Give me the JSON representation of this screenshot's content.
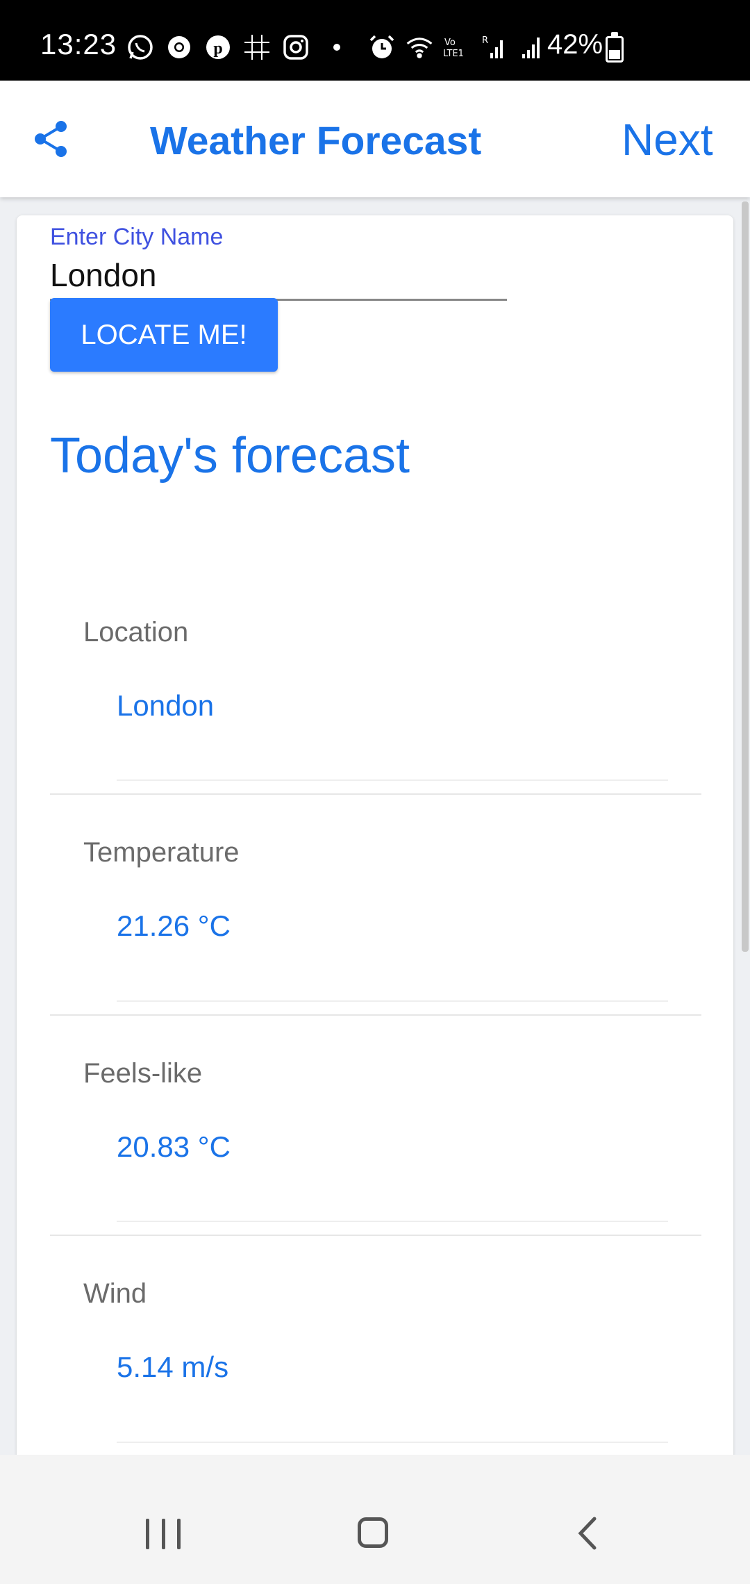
{
  "status_bar": {
    "time": "13:23",
    "battery": "42%",
    "icons": [
      "whatsapp-icon",
      "chrome-icon",
      "pinterest-icon",
      "sudoku-icon",
      "instagram-icon",
      "dot-icon",
      "alarm-icon",
      "wifi-icon",
      "volte-icon",
      "signal-icon",
      "signal-icon",
      "battery-charging-icon"
    ]
  },
  "app_bar": {
    "title": "Weather Forecast",
    "next_label": "Next",
    "share_icon": "share-icon"
  },
  "form": {
    "city_label": "Enter City Name",
    "city_value": "London",
    "locate_button": "LOCATE ME!"
  },
  "forecast": {
    "heading": "Today's forecast",
    "rows": [
      {
        "label": "Location",
        "value": "London"
      },
      {
        "label": "Temperature",
        "value": "21.26 °C"
      },
      {
        "label": "Feels-like",
        "value": "20.83 °C"
      },
      {
        "label": "Wind",
        "value": "5.14 m/s"
      }
    ]
  },
  "nav_bar": {
    "icons": [
      "recent-apps-icon",
      "home-icon",
      "back-icon"
    ]
  },
  "colors": {
    "accent": "#1a73e8",
    "button": "#2b7bff",
    "label": "#6b6b6b",
    "input_label": "#3f51e0"
  }
}
